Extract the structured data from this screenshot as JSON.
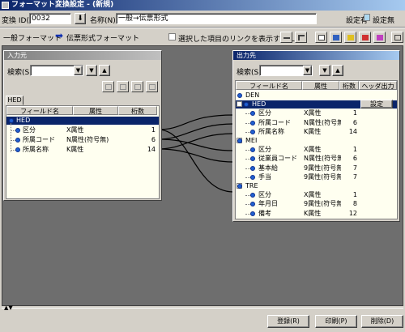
{
  "window": {
    "title": "フォーマット変換設定 - (新規)"
  },
  "header": {
    "conv_id_label": "変換 ID(I):",
    "conv_id_value": "0032",
    "name_label": "名称(N):",
    "name_value": "一般→伝票形式",
    "setting_present_label": "設定有",
    "setting_absent_label": "設定無"
  },
  "flow": {
    "source_format": "一般フォーマット",
    "target_format": "伝票形式フォーマット",
    "show_links_label": "選択した項目のリンクを表示する(L)"
  },
  "colors": {
    "selected": "#0a246a",
    "accent": "#2060d0",
    "grid_bg": "#fffff0",
    "setting_present": "#add8f0",
    "setting_absent": "#ffffe0"
  },
  "input_panel": {
    "title": "入力元",
    "search_label": "検索(S)",
    "tab": "HED",
    "columns": [
      "フィールド名",
      "属性",
      "桁数"
    ],
    "rows": [
      {
        "name": "HED",
        "attr": "",
        "digits": "",
        "selected": true
      },
      {
        "name": "区分",
        "attr": "X属性",
        "digits": "1"
      },
      {
        "name": "所属コード",
        "attr": "N属性(符号無)",
        "digits": "6"
      },
      {
        "name": "所属名称",
        "attr": "K属性",
        "digits": "14"
      }
    ]
  },
  "output_panel": {
    "title": "出力先",
    "search_label": "検索(S)",
    "columns": [
      "フィールド名",
      "属性",
      "桁数",
      "ヘッダ出力"
    ],
    "header_output_button": "設定",
    "rows": [
      {
        "name": "DEN",
        "attr": "",
        "digits": "",
        "level": 0
      },
      {
        "name": "HED",
        "attr": "",
        "digits": "",
        "level": 1,
        "selected": true
      },
      {
        "name": "区分",
        "attr": "X属性",
        "digits": "1",
        "level": 2
      },
      {
        "name": "所属コード",
        "attr": "N属性(符号無)",
        "digits": "6",
        "level": 2
      },
      {
        "name": "所属名称",
        "attr": "K属性",
        "digits": "14",
        "level": 2
      },
      {
        "name": "MEI",
        "attr": "",
        "digits": "",
        "level": 0
      },
      {
        "name": "区分",
        "attr": "X属性",
        "digits": "1",
        "level": 2
      },
      {
        "name": "従業員コード",
        "attr": "N属性(符号無)",
        "digits": "6",
        "level": 2
      },
      {
        "name": "基本給",
        "attr": "9属性(符号無)",
        "digits": "7",
        "level": 2
      },
      {
        "name": "手当",
        "attr": "9属性(符号無)",
        "digits": "7",
        "level": 2
      },
      {
        "name": "TRE",
        "attr": "",
        "digits": "",
        "level": 0
      },
      {
        "name": "区分",
        "attr": "X属性",
        "digits": "1",
        "level": 2
      },
      {
        "name": "年月日",
        "attr": "9属性(符号無)",
        "digits": "8",
        "level": 2
      },
      {
        "name": "備考",
        "attr": "K属性",
        "digits": "12",
        "level": 2
      }
    ]
  },
  "buttons": {
    "register": "登録(R)",
    "print": "印刷(P)",
    "delete": "削除(D)"
  }
}
